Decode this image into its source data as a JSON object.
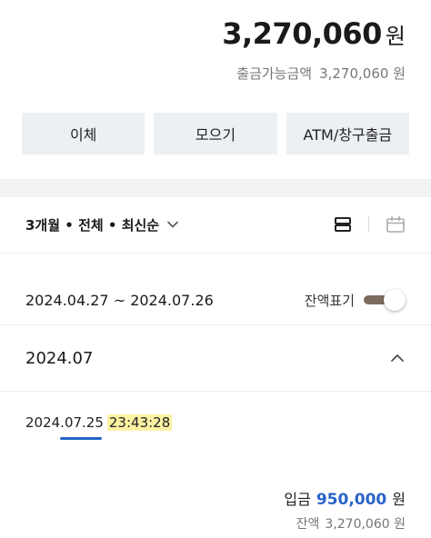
{
  "account": {
    "balance": "3,270,060",
    "currency_unit": "원",
    "available_label": "출금가능금액",
    "available_amount": "3,270,060 원"
  },
  "actions": [
    {
      "label": "이체"
    },
    {
      "label": "모으기"
    },
    {
      "label": "ATM/창구출금"
    }
  ],
  "filter": {
    "label": "3개월 • 전체 • 최신순"
  },
  "period": {
    "range": "2024.04.27 ~ 2024.07.26",
    "toggle_label": "잔액표기",
    "toggle_on": true
  },
  "month_group": {
    "month": "2024.07"
  },
  "transaction": {
    "date": "2024.07.25",
    "time": "23:43:28",
    "type_label": "입금",
    "amount": "950,000",
    "unit": "원",
    "balance_label": "잔액",
    "balance_amount": "3,270,060 원"
  },
  "colors": {
    "accent_blue": "#2b63c9",
    "toggle_track": "#7c6a5f",
    "highlight": "#fcf2a3",
    "button_bg": "#eceff3"
  }
}
